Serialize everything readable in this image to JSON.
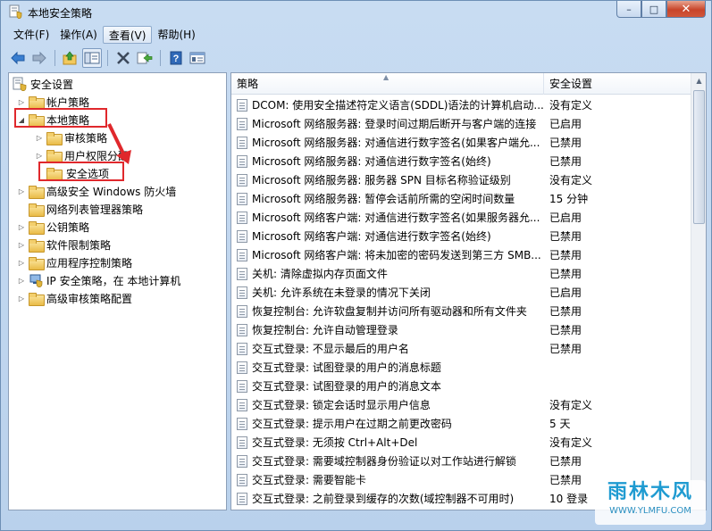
{
  "window": {
    "title": "本地安全策略",
    "controls": {
      "minimize": "–",
      "maximize": "□",
      "close": "✕"
    }
  },
  "menubar": {
    "items": [
      {
        "label": "文件(F)"
      },
      {
        "label": "操作(A)"
      },
      {
        "label": "查看(V)"
      },
      {
        "label": "帮助(H)"
      }
    ]
  },
  "toolbar": {
    "icons": [
      "back-arrow-icon",
      "forward-arrow-icon",
      "up-folder-icon",
      "show-hide-tree-icon",
      "delete-icon",
      "export-list-icon",
      "help-icon",
      "properties-icon"
    ]
  },
  "tree": {
    "root": "安全设置",
    "items": [
      {
        "label": "帐户策略",
        "level": 1,
        "expanded": false
      },
      {
        "label": "本地策略",
        "level": 1,
        "expanded": true
      },
      {
        "label": "审核策略",
        "level": 2,
        "expanded": false
      },
      {
        "label": "用户权限分配",
        "level": 2,
        "expanded": false
      },
      {
        "label": "安全选项",
        "level": 2,
        "selected": true
      },
      {
        "label": "高级安全 Windows 防火墙",
        "level": 1,
        "expanded": false
      },
      {
        "label": "网络列表管理器策略",
        "level": 1
      },
      {
        "label": "公钥策略",
        "level": 1,
        "expanded": false
      },
      {
        "label": "软件限制策略",
        "level": 1,
        "expanded": false
      },
      {
        "label": "应用程序控制策略",
        "level": 1,
        "expanded": false
      },
      {
        "label": "IP 安全策略，在 本地计算机",
        "level": 1,
        "expanded": false
      },
      {
        "label": "高级审核策略配置",
        "level": 1,
        "expanded": false
      }
    ]
  },
  "list": {
    "columns": {
      "policy": "策略",
      "setting": "安全设置"
    },
    "rows": [
      {
        "policy": "DCOM: 使用安全描述符定义语言(SDDL)语法的计算机启动...",
        "setting": "没有定义"
      },
      {
        "policy": "Microsoft 网络服务器: 登录时间过期后断开与客户端的连接",
        "setting": "已启用"
      },
      {
        "policy": "Microsoft 网络服务器: 对通信进行数字签名(如果客户端允...",
        "setting": "已禁用"
      },
      {
        "policy": "Microsoft 网络服务器: 对通信进行数字签名(始终)",
        "setting": "已禁用"
      },
      {
        "policy": "Microsoft 网络服务器: 服务器 SPN 目标名称验证级别",
        "setting": "没有定义"
      },
      {
        "policy": "Microsoft 网络服务器: 暂停会话前所需的空闲时间数量",
        "setting": "15 分钟"
      },
      {
        "policy": "Microsoft 网络客户端: 对通信进行数字签名(如果服务器允...",
        "setting": "已启用"
      },
      {
        "policy": "Microsoft 网络客户端: 对通信进行数字签名(始终)",
        "setting": "已禁用"
      },
      {
        "policy": "Microsoft 网络客户端: 将未加密的密码发送到第三方 SMB...",
        "setting": "已禁用"
      },
      {
        "policy": "关机: 清除虚拟内存页面文件",
        "setting": "已禁用"
      },
      {
        "policy": "关机: 允许系统在未登录的情况下关闭",
        "setting": "已启用"
      },
      {
        "policy": "恢复控制台: 允许软盘复制并访问所有驱动器和所有文件夹",
        "setting": "已禁用"
      },
      {
        "policy": "恢复控制台: 允许自动管理登录",
        "setting": "已禁用"
      },
      {
        "policy": "交互式登录: 不显示最后的用户名",
        "setting": "已禁用"
      },
      {
        "policy": "交互式登录: 试图登录的用户的消息标题",
        "setting": ""
      },
      {
        "policy": "交互式登录: 试图登录的用户的消息文本",
        "setting": ""
      },
      {
        "policy": "交互式登录: 锁定会话时显示用户信息",
        "setting": "没有定义"
      },
      {
        "policy": "交互式登录: 提示用户在过期之前更改密码",
        "setting": "5 天"
      },
      {
        "policy": "交互式登录: 无须按 Ctrl+Alt+Del",
        "setting": "没有定义"
      },
      {
        "policy": "交互式登录: 需要域控制器身份验证以对工作站进行解锁",
        "setting": "已禁用"
      },
      {
        "policy": "交互式登录: 需要智能卡",
        "setting": "已禁用"
      },
      {
        "policy": "交互式登录: 之前登录到缓存的次数(域控制器不可用时)",
        "setting": "10 登录"
      }
    ]
  },
  "watermark": {
    "main": "雨林木风",
    "sub": "WWW.YLMFU.COM"
  },
  "colors": {
    "highlight_box": "#e0282c",
    "accent": "#1f9bd1"
  }
}
